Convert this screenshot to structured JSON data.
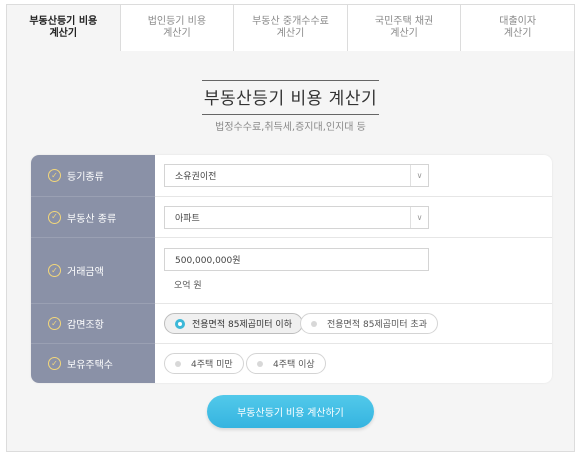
{
  "tabs": [
    {
      "label": "부동산등기 비용\n계산기",
      "active": true
    },
    {
      "label": "법인등기 비용\n계산기",
      "active": false
    },
    {
      "label": "부동산 중개수수료\n계산기",
      "active": false
    },
    {
      "label": "국민주택 채권\n계산기",
      "active": false
    },
    {
      "label": "대출이자\n계산기",
      "active": false
    }
  ],
  "header": {
    "title": "부동산등기 비용 계산기",
    "subtitle": "법정수수료,취득세,증지대,인지대 등"
  },
  "form": {
    "reg_type": {
      "label": "등기종류",
      "value": "소유권이전"
    },
    "property_type": {
      "label": "부동산 종류",
      "value": "아파트"
    },
    "amount": {
      "label": "거래금액",
      "value": "500,000,000원",
      "hint": "오억 원"
    },
    "reduction": {
      "label": "감면조항",
      "options": [
        "전용면적 85제곱미터 이하",
        "전용면적 85제곱미터 초과"
      ],
      "selected": 0
    },
    "houses": {
      "label": "보유주택수",
      "options": [
        "4주택 미만",
        "4주택 이상"
      ],
      "selected": -1
    }
  },
  "submit_label": "부동산등기 비용 계산하기",
  "colors": {
    "label_bg": "#8a91a7",
    "accent": "#3cb8d8",
    "check": "#f3d77a"
  }
}
